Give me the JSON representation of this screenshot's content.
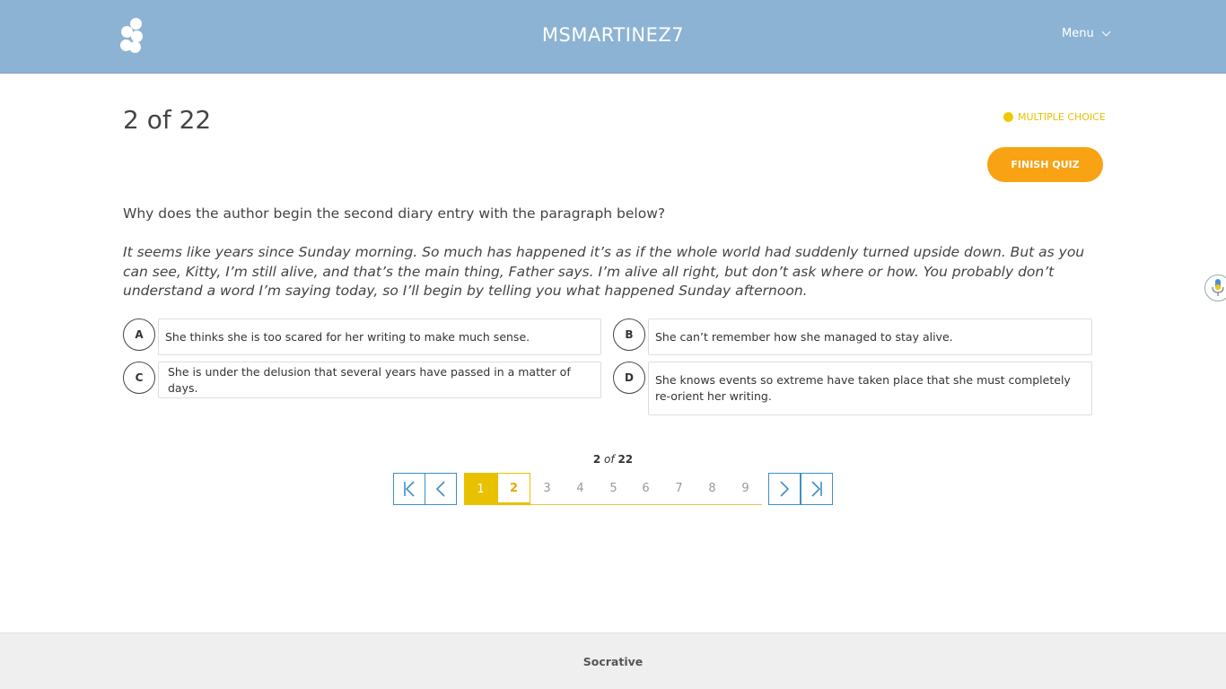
{
  "header": {
    "room_name": "MSMARTINEZ7",
    "menu_label": "Menu"
  },
  "quiz": {
    "question_count": "2 of 22",
    "question_type": "MULTIPLE CHOICE",
    "finish_label": "FINISH QUIZ",
    "question": "Why does the author begin the second diary entry with the paragraph below?",
    "passage": "It seems like years since Sunday morning. So much has happened it’s as if the whole world had suddenly turned upside down. But as you can see, Kitty, I’m still alive, and that’s the main thing, Father says. I’m alive all right, but don’t ask where or how. You probably don’t understand a word I’m saying today, so I’ll begin by telling you what happened Sunday afternoon.",
    "answers": [
      {
        "letter": "A",
        "text": "She thinks she is too scared for her writing to make much sense."
      },
      {
        "letter": "B",
        "text": "She can’t remember how she managed to stay alive."
      },
      {
        "letter": "C",
        "text": "She is under the delusion that several years have passed in a matter of days."
      },
      {
        "letter": "D",
        "text": "She knows events so extreme have taken place that she must completely re-orient her writing."
      }
    ]
  },
  "pagination": {
    "current": "2",
    "of": "of",
    "total": "22",
    "pages": [
      "1",
      "2",
      "3",
      "4",
      "5",
      "6",
      "7",
      "8",
      "9"
    ]
  },
  "footer": {
    "brand": "Socrative"
  },
  "colors": {
    "header_bg": "#8db3d4",
    "accent_yellow": "#e8c100",
    "finish_orange": "#f8a214",
    "nav_blue": "#3d8fc7"
  }
}
